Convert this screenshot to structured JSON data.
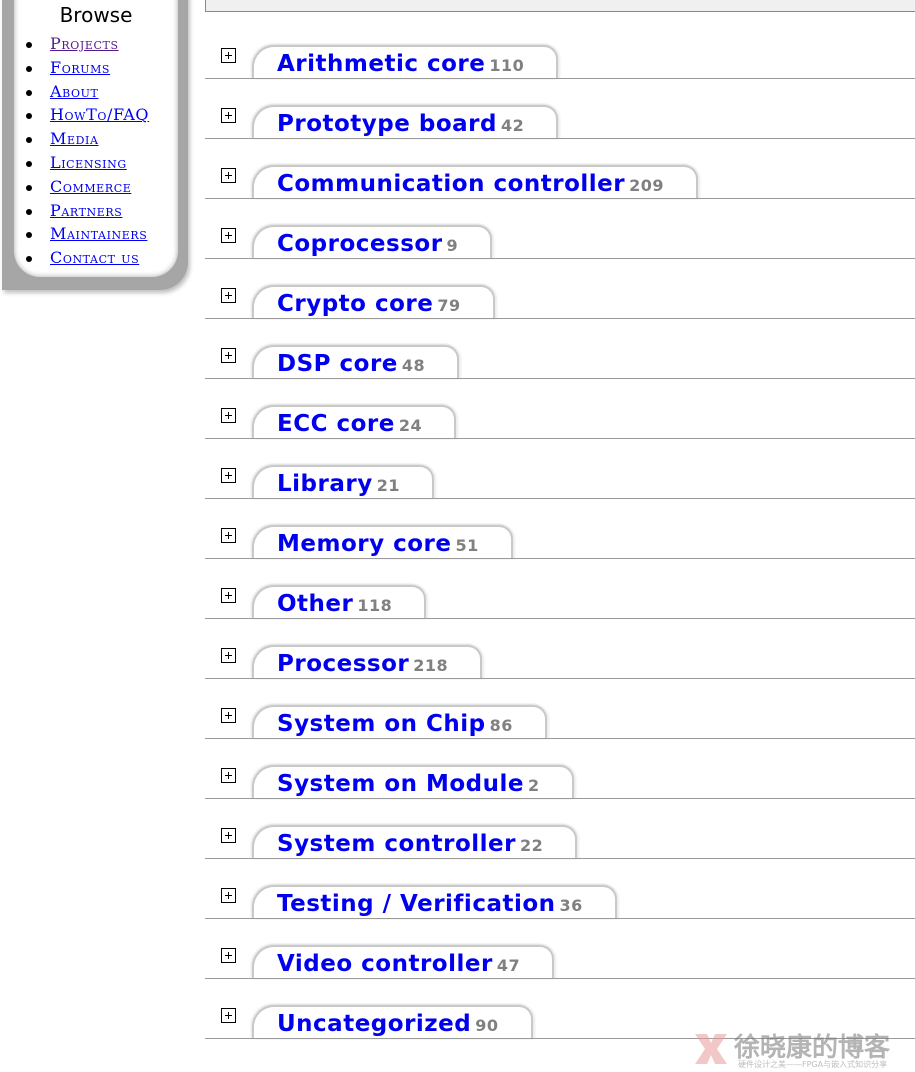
{
  "sidebar": {
    "title": "Browse",
    "items": [
      {
        "label": "Projects"
      },
      {
        "label": "Forums"
      },
      {
        "label": "About"
      },
      {
        "label": "HowTo/FAQ"
      },
      {
        "label": "Media"
      },
      {
        "label": "Licensing"
      },
      {
        "label": "Commerce"
      },
      {
        "label": "Partners"
      },
      {
        "label": "Maintainers"
      },
      {
        "label": "Contact us"
      }
    ]
  },
  "categories": [
    {
      "name": "Arithmetic core",
      "count": "110"
    },
    {
      "name": "Prototype board",
      "count": "42"
    },
    {
      "name": "Communication controller",
      "count": "209"
    },
    {
      "name": "Coprocessor",
      "count": "9"
    },
    {
      "name": "Crypto core",
      "count": "79"
    },
    {
      "name": "DSP core",
      "count": "48"
    },
    {
      "name": "ECC core",
      "count": "24"
    },
    {
      "name": "Library",
      "count": "21"
    },
    {
      "name": "Memory core",
      "count": "51"
    },
    {
      "name": "Other",
      "count": "118"
    },
    {
      "name": "Processor",
      "count": "218"
    },
    {
      "name": "System on Chip",
      "count": "86"
    },
    {
      "name": "System on Module",
      "count": "2"
    },
    {
      "name": "System controller",
      "count": "22"
    },
    {
      "name": "Testing / Verification",
      "count": "36"
    },
    {
      "name": "Video controller",
      "count": "47"
    },
    {
      "name": "Uncategorized",
      "count": "90"
    }
  ],
  "watermark": {
    "title": "徐晓康的博客",
    "subtitle": "硬件设计之美——FPGA与嵌入式知识分享"
  },
  "colors": {
    "link": "#0000ee",
    "visited_link": "#551a8b",
    "count": "#808080",
    "sidebar_frame": "#a6a6a6"
  },
  "icons": {
    "expand": "plus-box-icon",
    "bullet": "disc-bullet-icon"
  }
}
